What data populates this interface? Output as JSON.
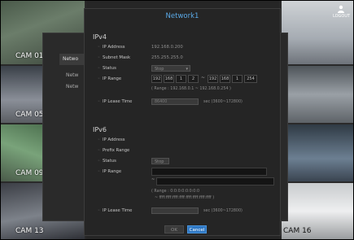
{
  "dialog": {
    "title": "Network1",
    "ok_label": "OK",
    "cancel_label": "Cancel"
  },
  "ipv4": {
    "section_title": "IPv4",
    "ip_address_label": "IP Address",
    "ip_address_value": "192.168.0.200",
    "subnet_mask_label": "Subnet Mask",
    "subnet_mask_value": "255.255.255.0",
    "status_label": "Status",
    "status_value": "Stop",
    "ip_range_label": "IP Range",
    "range_start": [
      "192",
      "168",
      "1",
      "2"
    ],
    "range_end": [
      "192",
      "168",
      "1",
      "254"
    ],
    "range_hint": "( Range : 192.168.0.1 ~ 192.168.0.254 )",
    "lease_time_label": "IP Lease Time",
    "lease_time_value": "86400",
    "lease_time_hint": "sec (3600~172800)"
  },
  "ipv6": {
    "section_title": "IPv6",
    "ip_address_label": "IP Address",
    "prefix_range_label": "Prefix Range",
    "status_label": "Status",
    "status_value": "Stop",
    "ip_range_label": "IP Range",
    "range_hint_1": "( Range : 0:0:0:0:0:0:0:0",
    "range_hint_2": "~ ffff:ffff:ffff:ffff:ffff:ffff:ffff:ffff )",
    "lease_time_label": "IP Lease Time",
    "lease_time_hint": "sec (3600~172800)"
  },
  "cameras": {
    "cam01": "CAM 01",
    "cam05": "CAM 05",
    "cam09": "CAM 09",
    "cam13": "CAM 13",
    "cam16": "CAM 16"
  },
  "underlying": {
    "tab_label": "Netwo",
    "row1": "Netw",
    "row2": "Netw"
  },
  "logout_label": "LOGOUT",
  "colors": {
    "accent": "#5aa9e6",
    "cancel_button": "#2f78c4"
  }
}
